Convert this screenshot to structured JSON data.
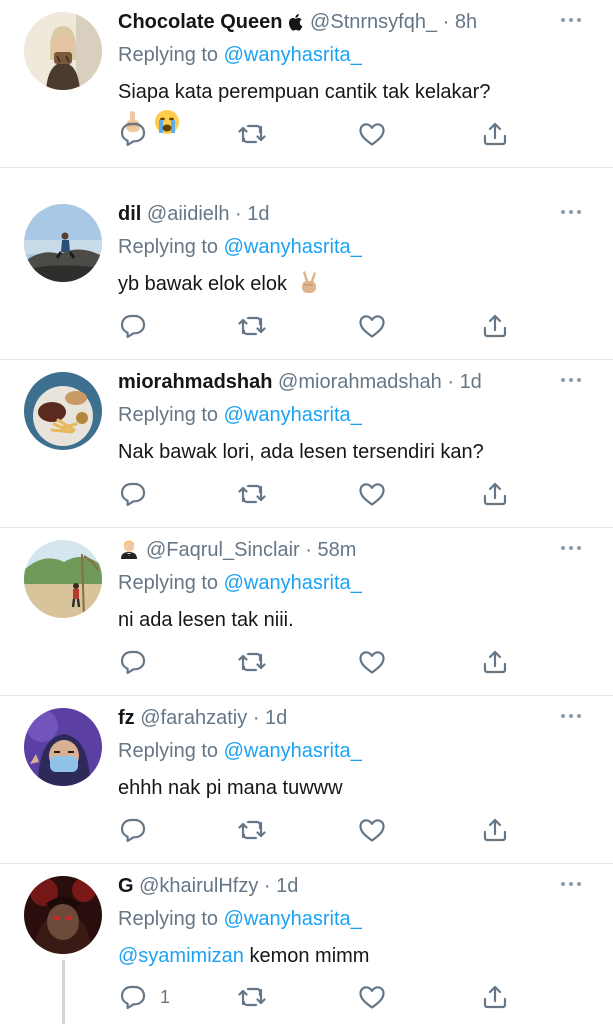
{
  "colors": {
    "accent": "#1da1f2",
    "muted": "#657786",
    "text": "#14171a",
    "divider": "#e1e8ed"
  },
  "replies": [
    {
      "name": "Chocolate Queen",
      "badge": "apple-icon",
      "handle": "@Stnrnsyfqh_",
      "sep": "·",
      "time": "8h",
      "replying_prefix": "Replying to",
      "replying_to": "@wanyhasrita_",
      "text": "Siapa kata perempuan cantik tak kelakar?",
      "emojis": [
        "pointing-up-icon",
        "crying-face-icon"
      ]
    },
    {
      "name": "dil",
      "handle": "@aiidielh",
      "sep": "·",
      "time": "1d",
      "replying_prefix": "Replying to",
      "replying_to": "@wanyhasrita_",
      "text": "yb bawak elok elok",
      "emojis": [
        "victory-hand-icon"
      ]
    },
    {
      "name": "miorahmadshah",
      "handle": "@miorahmadshah",
      "sep": "·",
      "time": "1d",
      "replying_prefix": "Replying to",
      "replying_to": "@wanyhasrita_",
      "text": "Nak bawak lori, ada lesen tersendiri kan?"
    },
    {
      "name": "",
      "badge": "man-in-tuxedo-icon",
      "handle": "@Faqrul_Sinclair",
      "sep": "·",
      "time": "58m",
      "replying_prefix": "Replying to",
      "replying_to": "@wanyhasrita_",
      "text": "ni ada lesen tak niii."
    },
    {
      "name": "fz",
      "handle": "@farahzatiy",
      "sep": "·",
      "time": "1d",
      "replying_prefix": "Replying to",
      "replying_to": "@wanyhasrita_",
      "text": "ehhh nak pi mana tuwww"
    },
    {
      "name": "G",
      "handle": "@khairulHfzy",
      "sep": "·",
      "time": "1d",
      "replying_prefix": "Replying to",
      "replying_to": "@wanyhasrita_",
      "mention": "@syamimizan",
      "text": " kemon mimm",
      "reply_count": "1"
    }
  ]
}
